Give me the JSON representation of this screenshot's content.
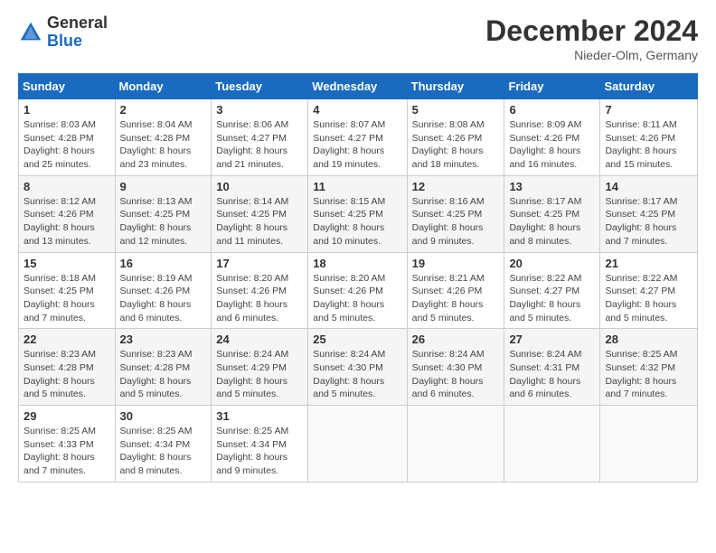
{
  "header": {
    "logo_general": "General",
    "logo_blue": "Blue",
    "month_title": "December 2024",
    "location": "Nieder-Olm, Germany"
  },
  "weekdays": [
    "Sunday",
    "Monday",
    "Tuesday",
    "Wednesday",
    "Thursday",
    "Friday",
    "Saturday"
  ],
  "weeks": [
    [
      {
        "day": "1",
        "sunrise": "8:03 AM",
        "sunset": "4:28 PM",
        "daylight": "8 hours and 25 minutes."
      },
      {
        "day": "2",
        "sunrise": "8:04 AM",
        "sunset": "4:28 PM",
        "daylight": "8 hours and 23 minutes."
      },
      {
        "day": "3",
        "sunrise": "8:06 AM",
        "sunset": "4:27 PM",
        "daylight": "8 hours and 21 minutes."
      },
      {
        "day": "4",
        "sunrise": "8:07 AM",
        "sunset": "4:27 PM",
        "daylight": "8 hours and 19 minutes."
      },
      {
        "day": "5",
        "sunrise": "8:08 AM",
        "sunset": "4:26 PM",
        "daylight": "8 hours and 18 minutes."
      },
      {
        "day": "6",
        "sunrise": "8:09 AM",
        "sunset": "4:26 PM",
        "daylight": "8 hours and 16 minutes."
      },
      {
        "day": "7",
        "sunrise": "8:11 AM",
        "sunset": "4:26 PM",
        "daylight": "8 hours and 15 minutes."
      }
    ],
    [
      {
        "day": "8",
        "sunrise": "8:12 AM",
        "sunset": "4:26 PM",
        "daylight": "8 hours and 13 minutes."
      },
      {
        "day": "9",
        "sunrise": "8:13 AM",
        "sunset": "4:25 PM",
        "daylight": "8 hours and 12 minutes."
      },
      {
        "day": "10",
        "sunrise": "8:14 AM",
        "sunset": "4:25 PM",
        "daylight": "8 hours and 11 minutes."
      },
      {
        "day": "11",
        "sunrise": "8:15 AM",
        "sunset": "4:25 PM",
        "daylight": "8 hours and 10 minutes."
      },
      {
        "day": "12",
        "sunrise": "8:16 AM",
        "sunset": "4:25 PM",
        "daylight": "8 hours and 9 minutes."
      },
      {
        "day": "13",
        "sunrise": "8:17 AM",
        "sunset": "4:25 PM",
        "daylight": "8 hours and 8 minutes."
      },
      {
        "day": "14",
        "sunrise": "8:17 AM",
        "sunset": "4:25 PM",
        "daylight": "8 hours and 7 minutes."
      }
    ],
    [
      {
        "day": "15",
        "sunrise": "8:18 AM",
        "sunset": "4:25 PM",
        "daylight": "8 hours and 7 minutes."
      },
      {
        "day": "16",
        "sunrise": "8:19 AM",
        "sunset": "4:26 PM",
        "daylight": "8 hours and 6 minutes."
      },
      {
        "day": "17",
        "sunrise": "8:20 AM",
        "sunset": "4:26 PM",
        "daylight": "8 hours and 6 minutes."
      },
      {
        "day": "18",
        "sunrise": "8:20 AM",
        "sunset": "4:26 PM",
        "daylight": "8 hours and 5 minutes."
      },
      {
        "day": "19",
        "sunrise": "8:21 AM",
        "sunset": "4:26 PM",
        "daylight": "8 hours and 5 minutes."
      },
      {
        "day": "20",
        "sunrise": "8:22 AM",
        "sunset": "4:27 PM",
        "daylight": "8 hours and 5 minutes."
      },
      {
        "day": "21",
        "sunrise": "8:22 AM",
        "sunset": "4:27 PM",
        "daylight": "8 hours and 5 minutes."
      }
    ],
    [
      {
        "day": "22",
        "sunrise": "8:23 AM",
        "sunset": "4:28 PM",
        "daylight": "8 hours and 5 minutes."
      },
      {
        "day": "23",
        "sunrise": "8:23 AM",
        "sunset": "4:28 PM",
        "daylight": "8 hours and 5 minutes."
      },
      {
        "day": "24",
        "sunrise": "8:24 AM",
        "sunset": "4:29 PM",
        "daylight": "8 hours and 5 minutes."
      },
      {
        "day": "25",
        "sunrise": "8:24 AM",
        "sunset": "4:30 PM",
        "daylight": "8 hours and 5 minutes."
      },
      {
        "day": "26",
        "sunrise": "8:24 AM",
        "sunset": "4:30 PM",
        "daylight": "8 hours and 6 minutes."
      },
      {
        "day": "27",
        "sunrise": "8:24 AM",
        "sunset": "4:31 PM",
        "daylight": "8 hours and 6 minutes."
      },
      {
        "day": "28",
        "sunrise": "8:25 AM",
        "sunset": "4:32 PM",
        "daylight": "8 hours and 7 minutes."
      }
    ],
    [
      {
        "day": "29",
        "sunrise": "8:25 AM",
        "sunset": "4:33 PM",
        "daylight": "8 hours and 7 minutes."
      },
      {
        "day": "30",
        "sunrise": "8:25 AM",
        "sunset": "4:34 PM",
        "daylight": "8 hours and 8 minutes."
      },
      {
        "day": "31",
        "sunrise": "8:25 AM",
        "sunset": "4:34 PM",
        "daylight": "8 hours and 9 minutes."
      },
      null,
      null,
      null,
      null
    ]
  ],
  "labels": {
    "sunrise": "Sunrise:",
    "sunset": "Sunset:",
    "daylight": "Daylight:"
  }
}
